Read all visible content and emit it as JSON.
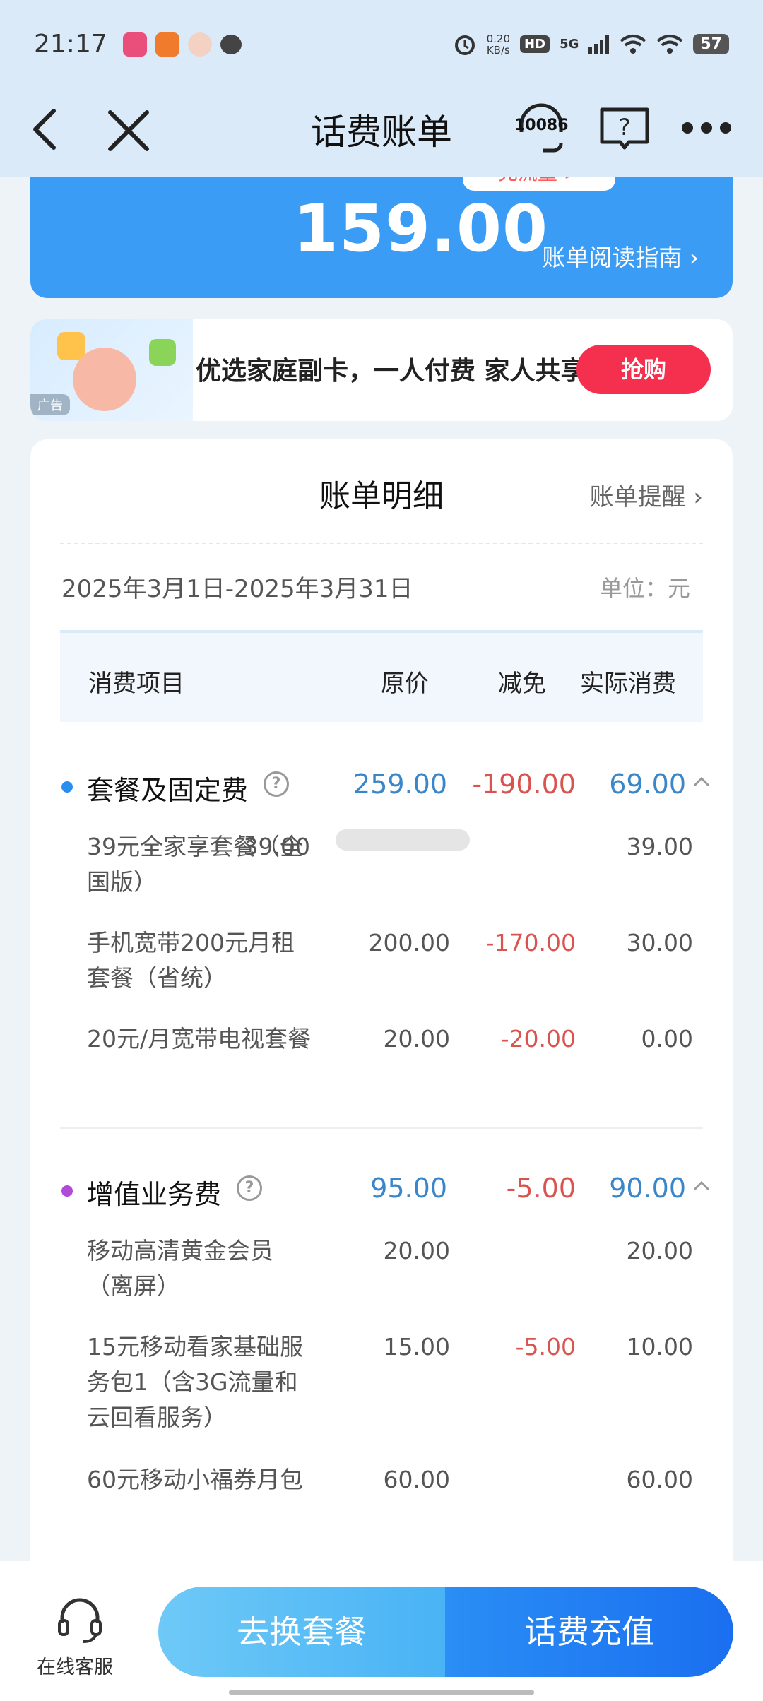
{
  "status_bar": {
    "time": "21:17",
    "net_speed": "0.20",
    "net_unit": "KB/s",
    "hd": "HD",
    "network": "5G",
    "battery": "57"
  },
  "header": {
    "title": "话费账单",
    "service_number": "10086"
  },
  "summary": {
    "flow_button": "充流量 >",
    "amount": "159.00",
    "guide_link": "账单阅读指南 ›"
  },
  "ad": {
    "label": "广告",
    "text": "优选家庭副卡，一人付费 家人共享",
    "button": "抢购"
  },
  "detail": {
    "title": "账单明细",
    "reminder": "账单提醒 ›",
    "period": "2025年3月1日-2025年3月31日",
    "unit": "单位：元",
    "columns": [
      "消费项目",
      "原价",
      "减免",
      "实际消费"
    ],
    "groups": [
      {
        "name": "套餐及固定费",
        "original": "259.00",
        "discount": "-190.00",
        "actual": "69.00",
        "items": [
          {
            "name": "39元全家享套餐（全国版）",
            "original": "39.00",
            "discount": "",
            "actual": "39.00"
          },
          {
            "name": "手机宽带200元月租套餐（省统）",
            "original": "200.00",
            "discount": "-170.00",
            "actual": "30.00"
          },
          {
            "name": "20元/月宽带电视套餐",
            "original": "20.00",
            "discount": "-20.00",
            "actual": "0.00"
          }
        ]
      },
      {
        "name": "增值业务费",
        "original": "95.00",
        "discount": "-5.00",
        "actual": "90.00",
        "items": [
          {
            "name": "移动高清黄金会员（离屏）",
            "original": "20.00",
            "discount": "",
            "actual": "20.00"
          },
          {
            "name": "15元移动看家基础服务包1（含3G流量和云回看服务）",
            "original": "15.00",
            "discount": "-5.00",
            "actual": "10.00"
          },
          {
            "name": "60元移动小福券月包",
            "original": "60.00",
            "discount": "",
            "actual": "60.00"
          }
        ]
      }
    ]
  },
  "bottom": {
    "service_label": "在线客服",
    "change_plan": "去换套餐",
    "recharge": "话费充值"
  },
  "colors": {
    "primary_blue": "#3a9cf5",
    "discount_red": "#d9534f",
    "value_blue": "#3a86c8",
    "buy_red": "#f5304f",
    "dot_purple": "#b04ad8"
  }
}
